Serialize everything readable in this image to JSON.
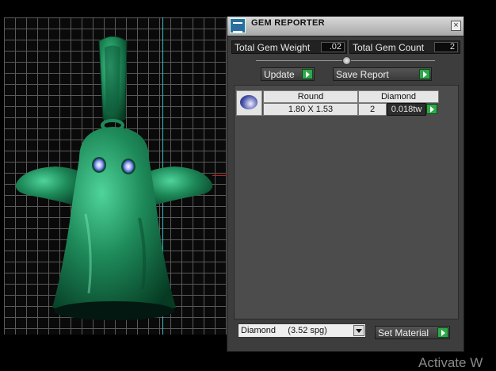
{
  "viewport": {
    "model_color": "#1f8a5a"
  },
  "gem_reporter": {
    "title": "GEM REPORTER",
    "total_weight_label": "Total Gem Weight",
    "total_weight_value": ".02",
    "total_count_label": "Total Gem Count",
    "total_count_value": "2",
    "update_label": "Update",
    "save_report_label": "Save Report",
    "report_rows": [
      {
        "cut": "Round",
        "size": "1.80 X 1.53",
        "material": "Diamond",
        "count": "2",
        "weight": "0.018tw"
      }
    ],
    "material_select": "Diamond     (3.52 spg)",
    "set_material_label": "Set Material"
  },
  "watermark": "Activate W"
}
